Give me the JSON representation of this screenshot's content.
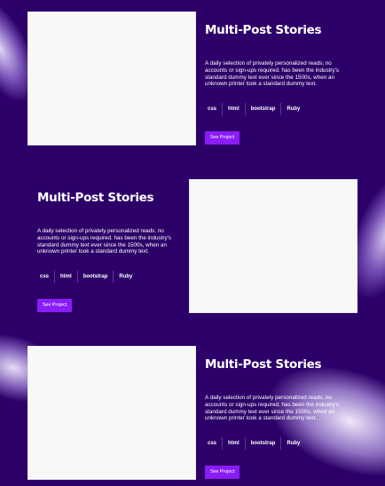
{
  "projects": [
    {
      "title": "Multi-Post Stories",
      "description": "A daily selection of privately personalized reads; no accounts or sign-ups required. has been the industry's standard dummy text ever since the 1500s, when an unknown printer took a standard dummy text.",
      "tags": [
        "css",
        "html",
        "bootstrap",
        "Ruby"
      ],
      "button_label": "See Project"
    },
    {
      "title": "Multi-Post Stories",
      "description": "A daily selection of privately personalized reads; no accounts or sign-ups required. has been the industry's standard dummy text ever since the 1500s, when an unknown printer took a standard dummy text.",
      "tags": [
        "css",
        "html",
        "bootstrap",
        "Ruby"
      ],
      "button_label": "See Project"
    },
    {
      "title": "Multi-Post Stories",
      "description": "A daily selection of privately personalized reads; no accounts or sign-ups required. has been the industry's standard dummy text ever since the 1500s, when an unknown printer took a standard dummy text.",
      "tags": [
        "css",
        "html",
        "bootstrap",
        "Ruby"
      ],
      "button_label": "See Project"
    }
  ],
  "colors": {
    "background": "#2c0068",
    "button": "#8a1cf7",
    "card": "#f8f8f8",
    "text": "#ffffff"
  }
}
